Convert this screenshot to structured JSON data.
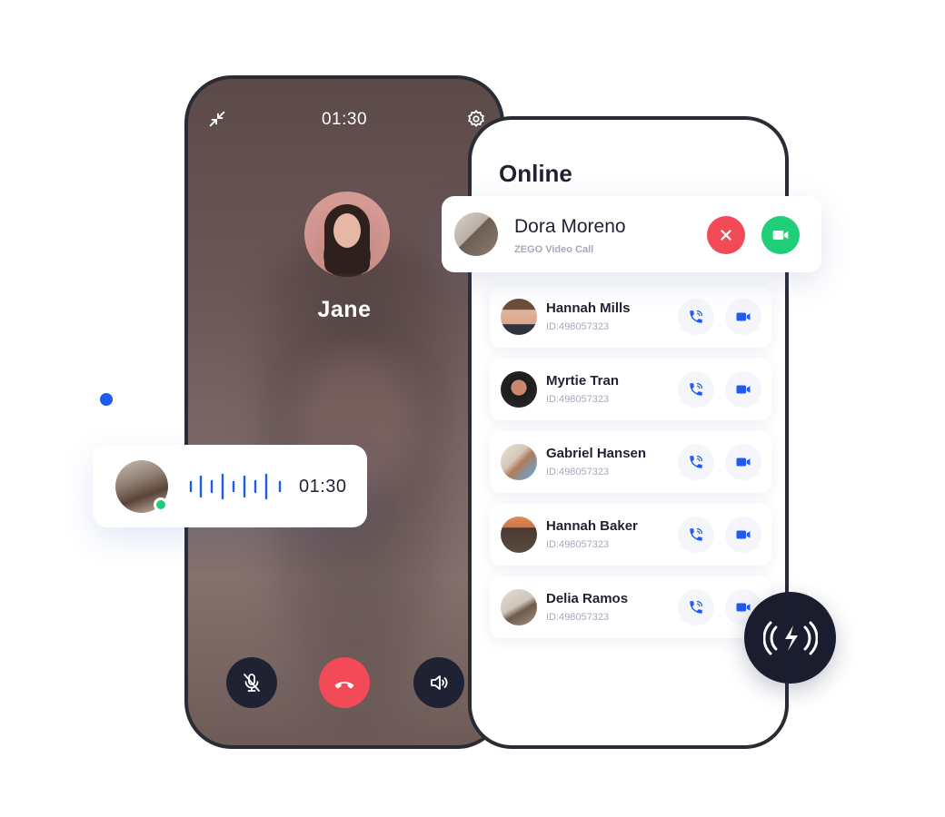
{
  "call_screen": {
    "timer": "01:30",
    "caller_name": "Jane",
    "icons": {
      "minimize": "minimize-icon",
      "settings": "settings-icon",
      "mute": "mic-off-icon",
      "hangup": "phone-hangup-icon",
      "speaker": "speaker-icon"
    }
  },
  "incoming_call": {
    "name": "Dora Moreno",
    "subtitle": "ZEGO Video Call",
    "decline_icon": "close-icon",
    "accept_icon": "video-camera-icon"
  },
  "contacts_screen": {
    "title": "Online",
    "contacts": [
      {
        "name": "Hannah Mills",
        "id": "ID:498057323"
      },
      {
        "name": "Myrtie Tran",
        "id": "ID:498057323"
      },
      {
        "name": "Gabriel Hansen",
        "id": "ID:498057323"
      },
      {
        "name": "Hannah Baker",
        "id": "ID:498057323"
      },
      {
        "name": "Delia Ramos",
        "id": "ID:498057323"
      }
    ]
  },
  "voice_message": {
    "duration": "01:30",
    "status": "online"
  },
  "colors": {
    "accent_blue": "#1e5bf0",
    "decline_red": "#f24a56",
    "accept_green": "#1fcf78",
    "dark": "#1f2233"
  }
}
